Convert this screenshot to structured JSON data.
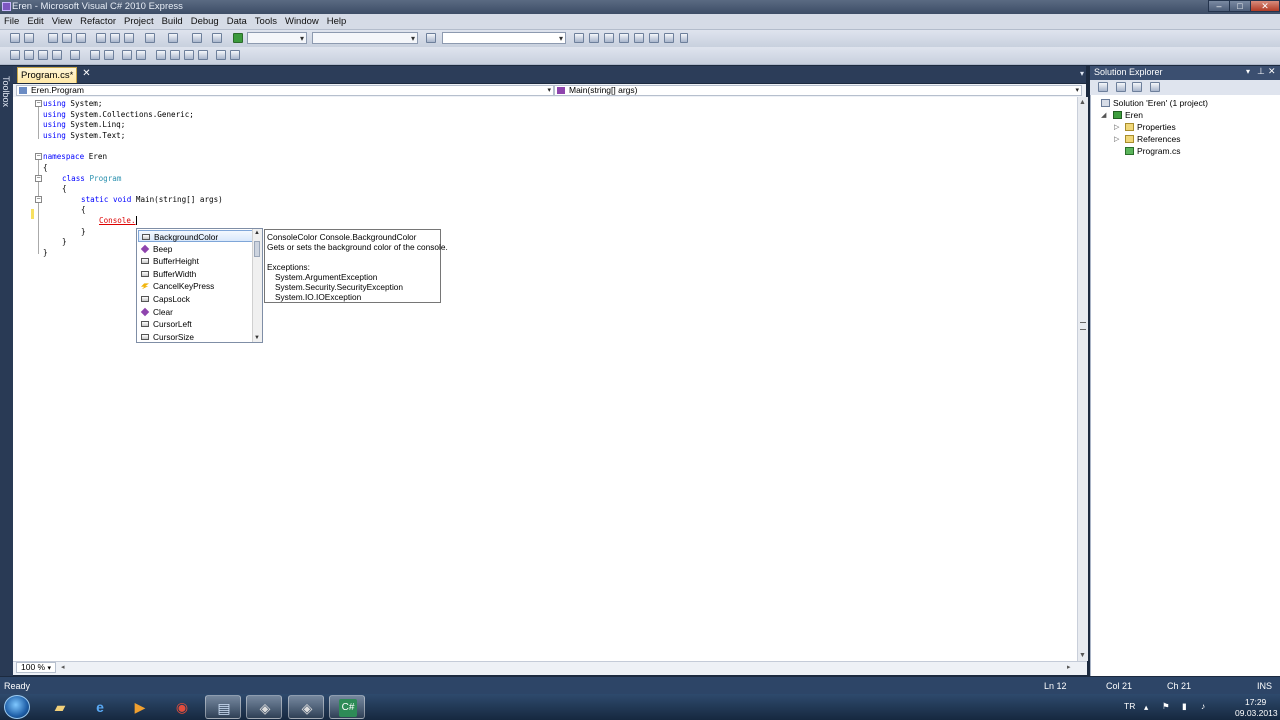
{
  "window": {
    "title": "Eren - Microsoft Visual C# 2010 Express"
  },
  "menu": [
    "File",
    "Edit",
    "View",
    "Refactor",
    "Project",
    "Build",
    "Debug",
    "Data",
    "Tools",
    "Window",
    "Help"
  ],
  "editor": {
    "tab_label": "Program.cs*",
    "nav_left": "Eren.Program",
    "nav_right": "Main(string[] args)",
    "zoom": "100 %"
  },
  "toolbox_label": "Toolbox",
  "code": {
    "l1": "using System;",
    "l2": "using System.Collections.Generic;",
    "l3": "using System.Linq;",
    "l4": "using System.Text;",
    "l5": "namespace Eren",
    "l6": "{",
    "l7_kw": "class",
    "l7_ty": "Program",
    "l8": "{",
    "l9_kw": "static void",
    "l9_rest": "Main(string[] args)",
    "l10": "{",
    "l11": "Console.",
    "l12": "}",
    "l13": "}",
    "l14": "}",
    "using_kw": "using",
    "ns_kw": "namespace"
  },
  "intellisense": {
    "items": [
      {
        "label": "BackgroundColor",
        "kind": "property"
      },
      {
        "label": "Beep",
        "kind": "method"
      },
      {
        "label": "BufferHeight",
        "kind": "property"
      },
      {
        "label": "BufferWidth",
        "kind": "property"
      },
      {
        "label": "CancelKeyPress",
        "kind": "event"
      },
      {
        "label": "CapsLock",
        "kind": "property"
      },
      {
        "label": "Clear",
        "kind": "method"
      },
      {
        "label": "CursorLeft",
        "kind": "property"
      },
      {
        "label": "CursorSize",
        "kind": "property"
      }
    ],
    "selected": "BackgroundColor"
  },
  "tooltip": {
    "signature": "ConsoleColor Console.BackgroundColor",
    "summary": "Gets or sets the background color of the console.",
    "exceptions_label": "Exceptions:",
    "exceptions": [
      "System.ArgumentException",
      "System.Security.SecurityException",
      "System.IO.IOException"
    ]
  },
  "solution_explorer": {
    "title": "Solution Explorer",
    "solution": "Solution 'Eren' (1 project)",
    "project": "Eren",
    "children": [
      "Properties",
      "References",
      "Program.cs"
    ]
  },
  "status": {
    "text": "Ready",
    "ln": "Ln 12",
    "col": "Col 21",
    "ch": "Ch 21",
    "mode": "INS"
  },
  "taskbar": {
    "lang": "TR",
    "time": "17:29",
    "date": "09.03.2013",
    "apps": [
      "explorer-icon",
      "ie-icon",
      "media-player-icon",
      "chrome-icon",
      "app-icon",
      "app-icon-2",
      "app-icon-3",
      "csharp-icon"
    ]
  },
  "colors": {
    "keyword": "#0000ff",
    "type": "#2b91af",
    "error": "#dd0000",
    "accent": "#2d4567"
  }
}
